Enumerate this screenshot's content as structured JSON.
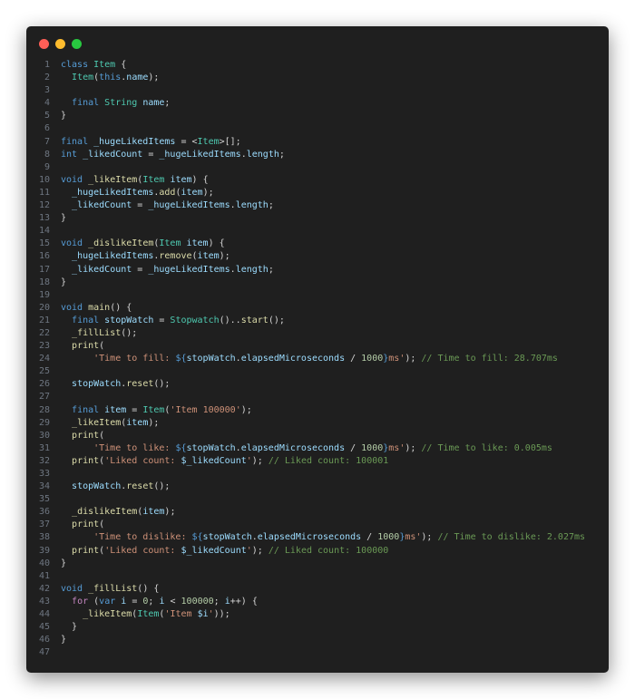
{
  "window": {
    "controls": [
      {
        "name": "close",
        "color": "#ff5f57"
      },
      {
        "name": "minimize",
        "color": "#febc2e"
      },
      {
        "name": "maximize",
        "color": "#28c840"
      }
    ]
  },
  "colors": {
    "keyword": "#569cd6",
    "control": "#c586c0",
    "type": "#4ec9b0",
    "func": "#dcdcaa",
    "string": "#ce9178",
    "number": "#b5cea8",
    "comment": "#6a9955",
    "text": "#d4d4d4",
    "variable": "#9cdcfe"
  },
  "lines": [
    [
      [
        "class ",
        "keyword"
      ],
      [
        "Item",
        "type"
      ],
      [
        " {",
        "text"
      ]
    ],
    [
      [
        "  ",
        "text"
      ],
      [
        "Item",
        "type"
      ],
      [
        "(",
        "text"
      ],
      [
        "this",
        "keyword"
      ],
      [
        ".",
        "text"
      ],
      [
        "name",
        "variable"
      ],
      [
        ");",
        "text"
      ]
    ],
    [],
    [
      [
        "  ",
        "text"
      ],
      [
        "final ",
        "keyword"
      ],
      [
        "String ",
        "type"
      ],
      [
        "name",
        "variable"
      ],
      [
        ";",
        "text"
      ]
    ],
    [
      [
        "}",
        "text"
      ]
    ],
    [],
    [
      [
        "final ",
        "keyword"
      ],
      [
        "_hugeLikedItems",
        "variable"
      ],
      [
        " = <",
        "text"
      ],
      [
        "Item",
        "type"
      ],
      [
        ">[];",
        "text"
      ]
    ],
    [
      [
        "int ",
        "keyword"
      ],
      [
        "_likedCount",
        "variable"
      ],
      [
        " = ",
        "text"
      ],
      [
        "_hugeLikedItems",
        "variable"
      ],
      [
        ".",
        "text"
      ],
      [
        "length",
        "variable"
      ],
      [
        ";",
        "text"
      ]
    ],
    [],
    [
      [
        "void ",
        "keyword"
      ],
      [
        "_likeItem",
        "func"
      ],
      [
        "(",
        "text"
      ],
      [
        "Item ",
        "type"
      ],
      [
        "item",
        "variable"
      ],
      [
        ") {",
        "text"
      ]
    ],
    [
      [
        "  ",
        "text"
      ],
      [
        "_hugeLikedItems",
        "variable"
      ],
      [
        ".",
        "text"
      ],
      [
        "add",
        "func"
      ],
      [
        "(",
        "text"
      ],
      [
        "item",
        "variable"
      ],
      [
        ");",
        "text"
      ]
    ],
    [
      [
        "  ",
        "text"
      ],
      [
        "_likedCount",
        "variable"
      ],
      [
        " = ",
        "text"
      ],
      [
        "_hugeLikedItems",
        "variable"
      ],
      [
        ".",
        "text"
      ],
      [
        "length",
        "variable"
      ],
      [
        ";",
        "text"
      ]
    ],
    [
      [
        "}",
        "text"
      ]
    ],
    [],
    [
      [
        "void ",
        "keyword"
      ],
      [
        "_dislikeItem",
        "func"
      ],
      [
        "(",
        "text"
      ],
      [
        "Item ",
        "type"
      ],
      [
        "item",
        "variable"
      ],
      [
        ") {",
        "text"
      ]
    ],
    [
      [
        "  ",
        "text"
      ],
      [
        "_hugeLikedItems",
        "variable"
      ],
      [
        ".",
        "text"
      ],
      [
        "remove",
        "func"
      ],
      [
        "(",
        "text"
      ],
      [
        "item",
        "variable"
      ],
      [
        ");",
        "text"
      ]
    ],
    [
      [
        "  ",
        "text"
      ],
      [
        "_likedCount",
        "variable"
      ],
      [
        " = ",
        "text"
      ],
      [
        "_hugeLikedItems",
        "variable"
      ],
      [
        ".",
        "text"
      ],
      [
        "length",
        "variable"
      ],
      [
        ";",
        "text"
      ]
    ],
    [
      [
        "}",
        "text"
      ]
    ],
    [],
    [
      [
        "void ",
        "keyword"
      ],
      [
        "main",
        "func"
      ],
      [
        "() {",
        "text"
      ]
    ],
    [
      [
        "  ",
        "text"
      ],
      [
        "final ",
        "keyword"
      ],
      [
        "stopWatch",
        "variable"
      ],
      [
        " = ",
        "text"
      ],
      [
        "Stopwatch",
        "type"
      ],
      [
        "()..",
        "text"
      ],
      [
        "start",
        "func"
      ],
      [
        "();",
        "text"
      ]
    ],
    [
      [
        "  ",
        "text"
      ],
      [
        "_fillList",
        "func"
      ],
      [
        "();",
        "text"
      ]
    ],
    [
      [
        "  ",
        "text"
      ],
      [
        "print",
        "func"
      ],
      [
        "(",
        "text"
      ]
    ],
    [
      [
        "      ",
        "text"
      ],
      [
        "'Time to fill: ",
        "string"
      ],
      [
        "${",
        "keyword"
      ],
      [
        "stopWatch",
        "variable"
      ],
      [
        ".",
        "text"
      ],
      [
        "elapsedMicroseconds",
        "variable"
      ],
      [
        " / ",
        "text"
      ],
      [
        "1000",
        "number"
      ],
      [
        "}",
        "keyword"
      ],
      [
        "ms'",
        "string"
      ],
      [
        "); ",
        "text"
      ],
      [
        "// Time to fill: 28.707ms",
        "comment"
      ]
    ],
    [],
    [
      [
        "  ",
        "text"
      ],
      [
        "stopWatch",
        "variable"
      ],
      [
        ".",
        "text"
      ],
      [
        "reset",
        "func"
      ],
      [
        "();",
        "text"
      ]
    ],
    [],
    [
      [
        "  ",
        "text"
      ],
      [
        "final ",
        "keyword"
      ],
      [
        "item",
        "variable"
      ],
      [
        " = ",
        "text"
      ],
      [
        "Item",
        "type"
      ],
      [
        "(",
        "text"
      ],
      [
        "'Item 100000'",
        "string"
      ],
      [
        ");",
        "text"
      ]
    ],
    [
      [
        "  ",
        "text"
      ],
      [
        "_likeItem",
        "func"
      ],
      [
        "(",
        "text"
      ],
      [
        "item",
        "variable"
      ],
      [
        ");",
        "text"
      ]
    ],
    [
      [
        "  ",
        "text"
      ],
      [
        "print",
        "func"
      ],
      [
        "(",
        "text"
      ]
    ],
    [
      [
        "      ",
        "text"
      ],
      [
        "'Time to like: ",
        "string"
      ],
      [
        "${",
        "keyword"
      ],
      [
        "stopWatch",
        "variable"
      ],
      [
        ".",
        "text"
      ],
      [
        "elapsedMicroseconds",
        "variable"
      ],
      [
        " / ",
        "text"
      ],
      [
        "1000",
        "number"
      ],
      [
        "}",
        "keyword"
      ],
      [
        "ms'",
        "string"
      ],
      [
        "); ",
        "text"
      ],
      [
        "// Time to like: 0.005ms",
        "comment"
      ]
    ],
    [
      [
        "  ",
        "text"
      ],
      [
        "print",
        "func"
      ],
      [
        "(",
        "text"
      ],
      [
        "'Liked count: ",
        "string"
      ],
      [
        "$_likedCount",
        "variable"
      ],
      [
        "'",
        "string"
      ],
      [
        "); ",
        "text"
      ],
      [
        "// Liked count: 100001",
        "comment"
      ]
    ],
    [],
    [
      [
        "  ",
        "text"
      ],
      [
        "stopWatch",
        "variable"
      ],
      [
        ".",
        "text"
      ],
      [
        "reset",
        "func"
      ],
      [
        "();",
        "text"
      ]
    ],
    [],
    [
      [
        "  ",
        "text"
      ],
      [
        "_dislikeItem",
        "func"
      ],
      [
        "(",
        "text"
      ],
      [
        "item",
        "variable"
      ],
      [
        ");",
        "text"
      ]
    ],
    [
      [
        "  ",
        "text"
      ],
      [
        "print",
        "func"
      ],
      [
        "(",
        "text"
      ]
    ],
    [
      [
        "      ",
        "text"
      ],
      [
        "'Time to dislike: ",
        "string"
      ],
      [
        "${",
        "keyword"
      ],
      [
        "stopWatch",
        "variable"
      ],
      [
        ".",
        "text"
      ],
      [
        "elapsedMicroseconds",
        "variable"
      ],
      [
        " / ",
        "text"
      ],
      [
        "1000",
        "number"
      ],
      [
        "}",
        "keyword"
      ],
      [
        "ms'",
        "string"
      ],
      [
        "); ",
        "text"
      ],
      [
        "// Time to dislike: 2.027ms",
        "comment"
      ]
    ],
    [
      [
        "  ",
        "text"
      ],
      [
        "print",
        "func"
      ],
      [
        "(",
        "text"
      ],
      [
        "'Liked count: ",
        "string"
      ],
      [
        "$_likedCount",
        "variable"
      ],
      [
        "'",
        "string"
      ],
      [
        "); ",
        "text"
      ],
      [
        "// Liked count: 100000",
        "comment"
      ]
    ],
    [
      [
        "}",
        "text"
      ]
    ],
    [],
    [
      [
        "void ",
        "keyword"
      ],
      [
        "_fillList",
        "func"
      ],
      [
        "() {",
        "text"
      ]
    ],
    [
      [
        "  ",
        "text"
      ],
      [
        "for ",
        "control"
      ],
      [
        "(",
        "text"
      ],
      [
        "var ",
        "keyword"
      ],
      [
        "i",
        "variable"
      ],
      [
        " = ",
        "text"
      ],
      [
        "0",
        "number"
      ],
      [
        "; ",
        "text"
      ],
      [
        "i",
        "variable"
      ],
      [
        " < ",
        "text"
      ],
      [
        "100000",
        "number"
      ],
      [
        "; ",
        "text"
      ],
      [
        "i",
        "variable"
      ],
      [
        "++) {",
        "text"
      ]
    ],
    [
      [
        "    ",
        "text"
      ],
      [
        "_likeItem",
        "func"
      ],
      [
        "(",
        "text"
      ],
      [
        "Item",
        "type"
      ],
      [
        "(",
        "text"
      ],
      [
        "'Item ",
        "string"
      ],
      [
        "$i",
        "variable"
      ],
      [
        "'",
        "string"
      ],
      [
        "));",
        "text"
      ]
    ],
    [
      [
        "  }",
        "text"
      ]
    ],
    [
      [
        "}",
        "text"
      ]
    ],
    []
  ]
}
